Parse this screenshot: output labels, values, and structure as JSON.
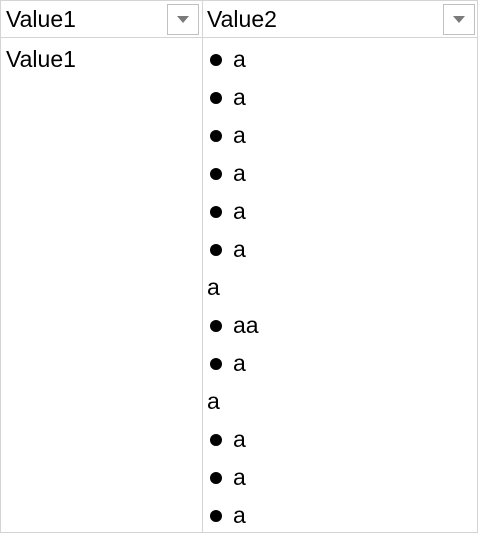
{
  "table": {
    "headers": [
      {
        "label": "Value1"
      },
      {
        "label": "Value2"
      }
    ],
    "row": {
      "value1": "Value1",
      "value2_lines": [
        {
          "text": "a",
          "bullet": true
        },
        {
          "text": "a",
          "bullet": true
        },
        {
          "text": "a",
          "bullet": true
        },
        {
          "text": "a",
          "bullet": true
        },
        {
          "text": "a",
          "bullet": true
        },
        {
          "text": "a",
          "bullet": true
        },
        {
          "text": "a",
          "bullet": false
        },
        {
          "text": "aa",
          "bullet": true
        },
        {
          "text": "a",
          "bullet": true
        },
        {
          "text": "a",
          "bullet": false
        },
        {
          "text": "a",
          "bullet": true
        },
        {
          "text": "a",
          "bullet": true
        },
        {
          "text": "a",
          "bullet": true
        }
      ]
    }
  },
  "icons": {
    "filter": "dropdown-arrow-icon",
    "bullet": "bullet-dot-icon"
  },
  "colors": {
    "gridline": "#d4d4d4",
    "filter_border": "#c0c0c0",
    "filter_arrow": "#7a7a7a"
  }
}
